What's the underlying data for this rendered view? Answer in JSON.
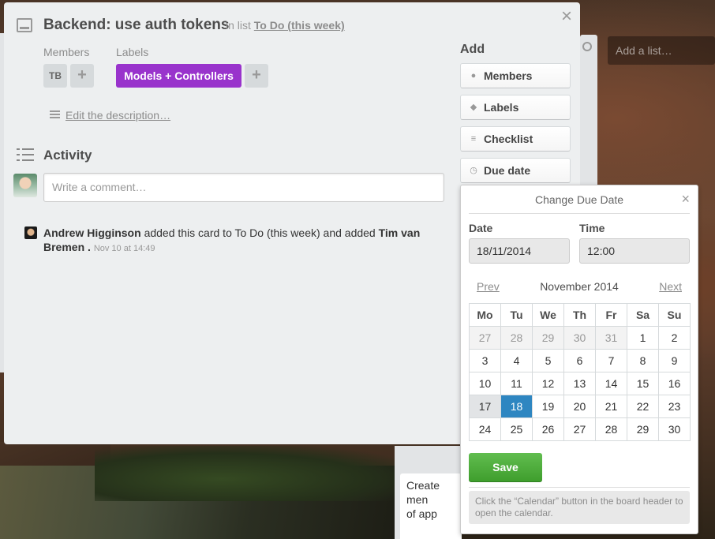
{
  "background": {
    "add_list_placeholder": "Add a list…",
    "card_snippet": "Create men\nof app"
  },
  "card": {
    "title": "Backend: use auth tokens",
    "in_list_prefix": "in list",
    "list_name": "To Do (this week)",
    "members_label": "Members",
    "labels_label": "Labels",
    "member_initials": "TB",
    "label_name": "Models + Controllers",
    "label_color": "#9933cc",
    "add_member": "+",
    "add_label": "+",
    "description_link": "Edit the description…",
    "activity_heading": "Activity",
    "comment_placeholder": "Write a comment…",
    "activity": {
      "actor": "Andrew Higginson",
      "text": "added this card to To Do (this week) and added",
      "target": "Tim van Bremen",
      "suffix": ".",
      "date": "Nov 10 at 14:49"
    }
  },
  "sidebar": {
    "heading": "Add",
    "buttons": [
      {
        "label": "Members",
        "icon": "person-icon"
      },
      {
        "label": "Labels",
        "icon": "tag-icon"
      },
      {
        "label": "Checklist",
        "icon": "checklist-icon"
      },
      {
        "label": "Due date",
        "icon": "clock-icon"
      }
    ]
  },
  "due_date": {
    "title": "Change Due Date",
    "date_label": "Date",
    "date_value": "18/11/2014",
    "time_label": "Time",
    "time_value": "12:00",
    "prev": "Prev",
    "next": "Next",
    "month": "November 2014",
    "weekdays": [
      "Mo",
      "Tu",
      "We",
      "Th",
      "Fr",
      "Sa",
      "Su"
    ],
    "weeks": [
      [
        "27",
        "28",
        "29",
        "30",
        "31",
        "1",
        "2"
      ],
      [
        "3",
        "4",
        "5",
        "6",
        "7",
        "8",
        "9"
      ],
      [
        "10",
        "11",
        "12",
        "13",
        "14",
        "15",
        "16"
      ],
      [
        "17",
        "18",
        "19",
        "20",
        "21",
        "22",
        "23"
      ],
      [
        "24",
        "25",
        "26",
        "27",
        "28",
        "29",
        "30"
      ]
    ],
    "selected_day": "18",
    "today_day": "17",
    "save": "Save",
    "hint": "Click the “Calendar” button in the board header to open the calendar."
  },
  "colors": {
    "save_green": "#5aac44",
    "selected_blue": "#2e86c1"
  }
}
